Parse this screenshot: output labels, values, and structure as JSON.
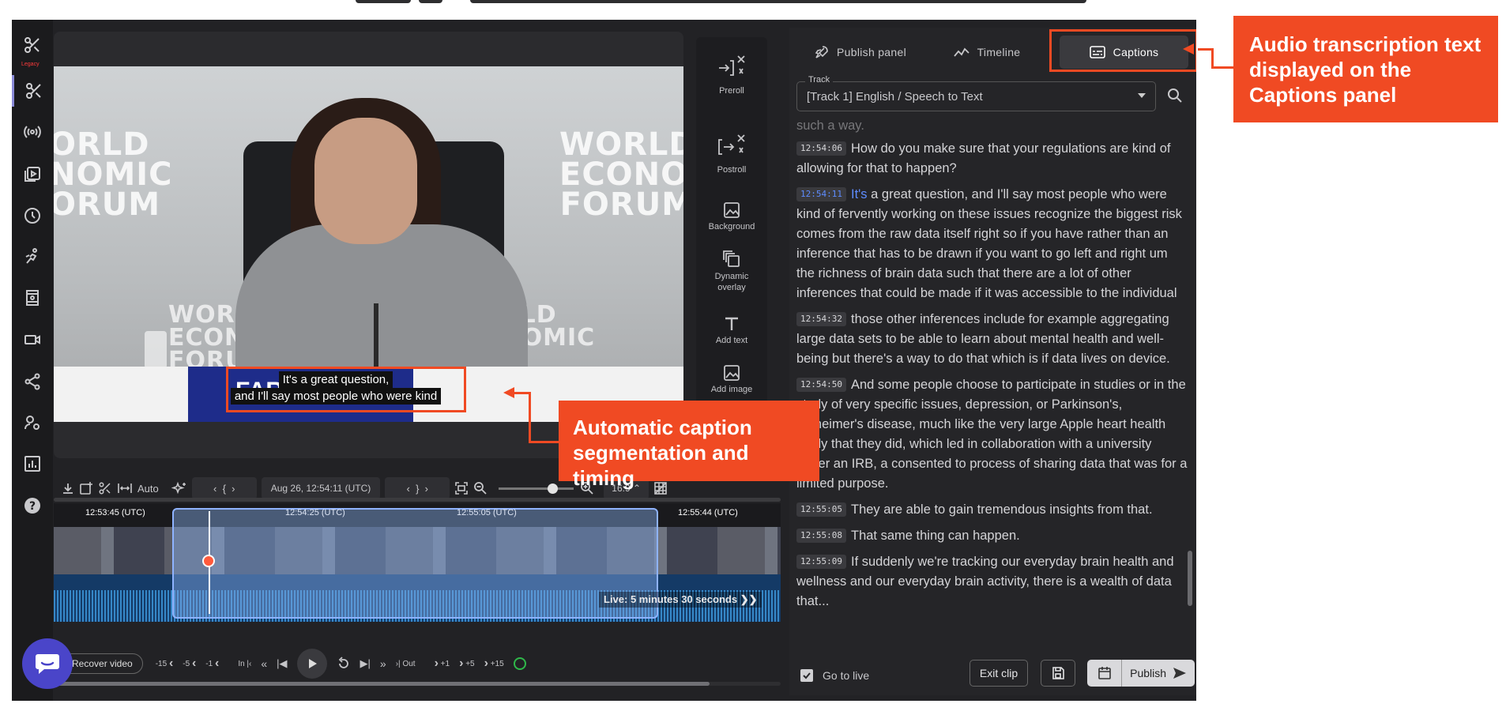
{
  "app": {
    "rail": [
      "scissors-legacy-icon",
      "scissors-icon",
      "broadcast-icon",
      "video-library-icon",
      "clock-icon",
      "sport-icon",
      "film-icon",
      "camera-icon",
      "share-icon",
      "user-settings-icon",
      "analytics-icon",
      "help-icon"
    ],
    "legacy_label": "Legacy"
  },
  "video": {
    "watermark_lines": [
      "WORLD",
      "ECONOMIC",
      "FORUM"
    ],
    "watermark_left": [
      "ORLD",
      "NOMIC",
      "ORUM"
    ],
    "watermark_right": [
      "WORLD",
      "ECONOMIC",
      "FORUM"
    ],
    "watermark_mid_left": [
      "WOR",
      "ECON",
      "FORUM"
    ],
    "watermark_mid_right": [
      "ORLD",
      "ONOMIC",
      "UM"
    ],
    "desk_label": "FARA",
    "caption_line1": "It's a great question,",
    "caption_line2": "and I'll say most people who were kind"
  },
  "tools": [
    {
      "name": "preroll",
      "label": "Preroll"
    },
    {
      "name": "postroll",
      "label": "Postroll"
    },
    {
      "name": "background",
      "label": "Background"
    },
    {
      "name": "dynamic-overlay",
      "label": "Dynamic overlay"
    },
    {
      "name": "add-text",
      "label": "Add text"
    },
    {
      "name": "add-image",
      "label": "Add image"
    }
  ],
  "editbar": {
    "auto": "Auto",
    "timestamp": "Aug 26, 12:54:11 (UTC)",
    "aspect": "16:9"
  },
  "timeline": {
    "labels": [
      "12:53:45 (UTC)",
      "12:54:25 (UTC)",
      "12:55:05 (UTC)",
      "12:55:44 (UTC)"
    ],
    "live": "Live: 5 minutes 30 seconds"
  },
  "transport": {
    "recover": "Recover video",
    "jumps_back": [
      "-15",
      "-5",
      "-1"
    ],
    "in": "In",
    "out": "Out",
    "jumps_fwd": [
      "+1",
      "+5",
      "+15"
    ]
  },
  "panel": {
    "tabs": [
      "Publish panel",
      "Timeline",
      "Captions"
    ],
    "active_tab": "Captions",
    "track_label": "Track",
    "track_value": "[Track 1] English / Speech to Text",
    "transcript_lead": "such a way.",
    "segments": [
      {
        "ts": "12:54:06",
        "text": "How do you make sure that your regulations are kind of allowing for that to happen?"
      },
      {
        "ts": "12:54:11",
        "hl": "It's",
        "text": " a great question, and I'll say most people who were kind of fervently working on these issues recognize the biggest risk comes from the raw data itself right so if you have rather than an inference that has to be drawn if you want to go left and right um the richness of brain data such that there are a lot of other inferences that could be made if it was accessible to the individual"
      },
      {
        "ts": "12:54:32",
        "text": "those other inferences include for example aggregating large data sets to be able to learn about mental health and well-being but there's a way to do that which is if data lives on device."
      },
      {
        "ts": "12:54:50",
        "text": "And some people choose to participate in studies or in the study of very specific issues, depression, or Parkinson's, Alzheimer's disease, much like the very large Apple heart health study that they did, which led in collaboration with a university under an IRB, a consented to process of sharing data that was for a limited purpose."
      },
      {
        "ts": "12:55:05",
        "text": "They are able to gain tremendous insights from that."
      },
      {
        "ts": "12:55:08",
        "text": "That same thing can happen."
      },
      {
        "ts": "12:55:09",
        "text": "If suddenly we're tracking our everyday brain health and wellness and our everyday brain activity, there is a wealth of data that..."
      }
    ],
    "go_live": "Go to live",
    "exit_clip": "Exit clip",
    "publish": "Publish"
  },
  "annotations": {
    "captions_callout": "Audio transcription text displayed on the Captions panel",
    "caption_callout": "Automatic caption segmentation and timing"
  },
  "colors": {
    "accent": "#f04a23",
    "highlight": "#5e8cff",
    "fab": "#4a45c9"
  }
}
